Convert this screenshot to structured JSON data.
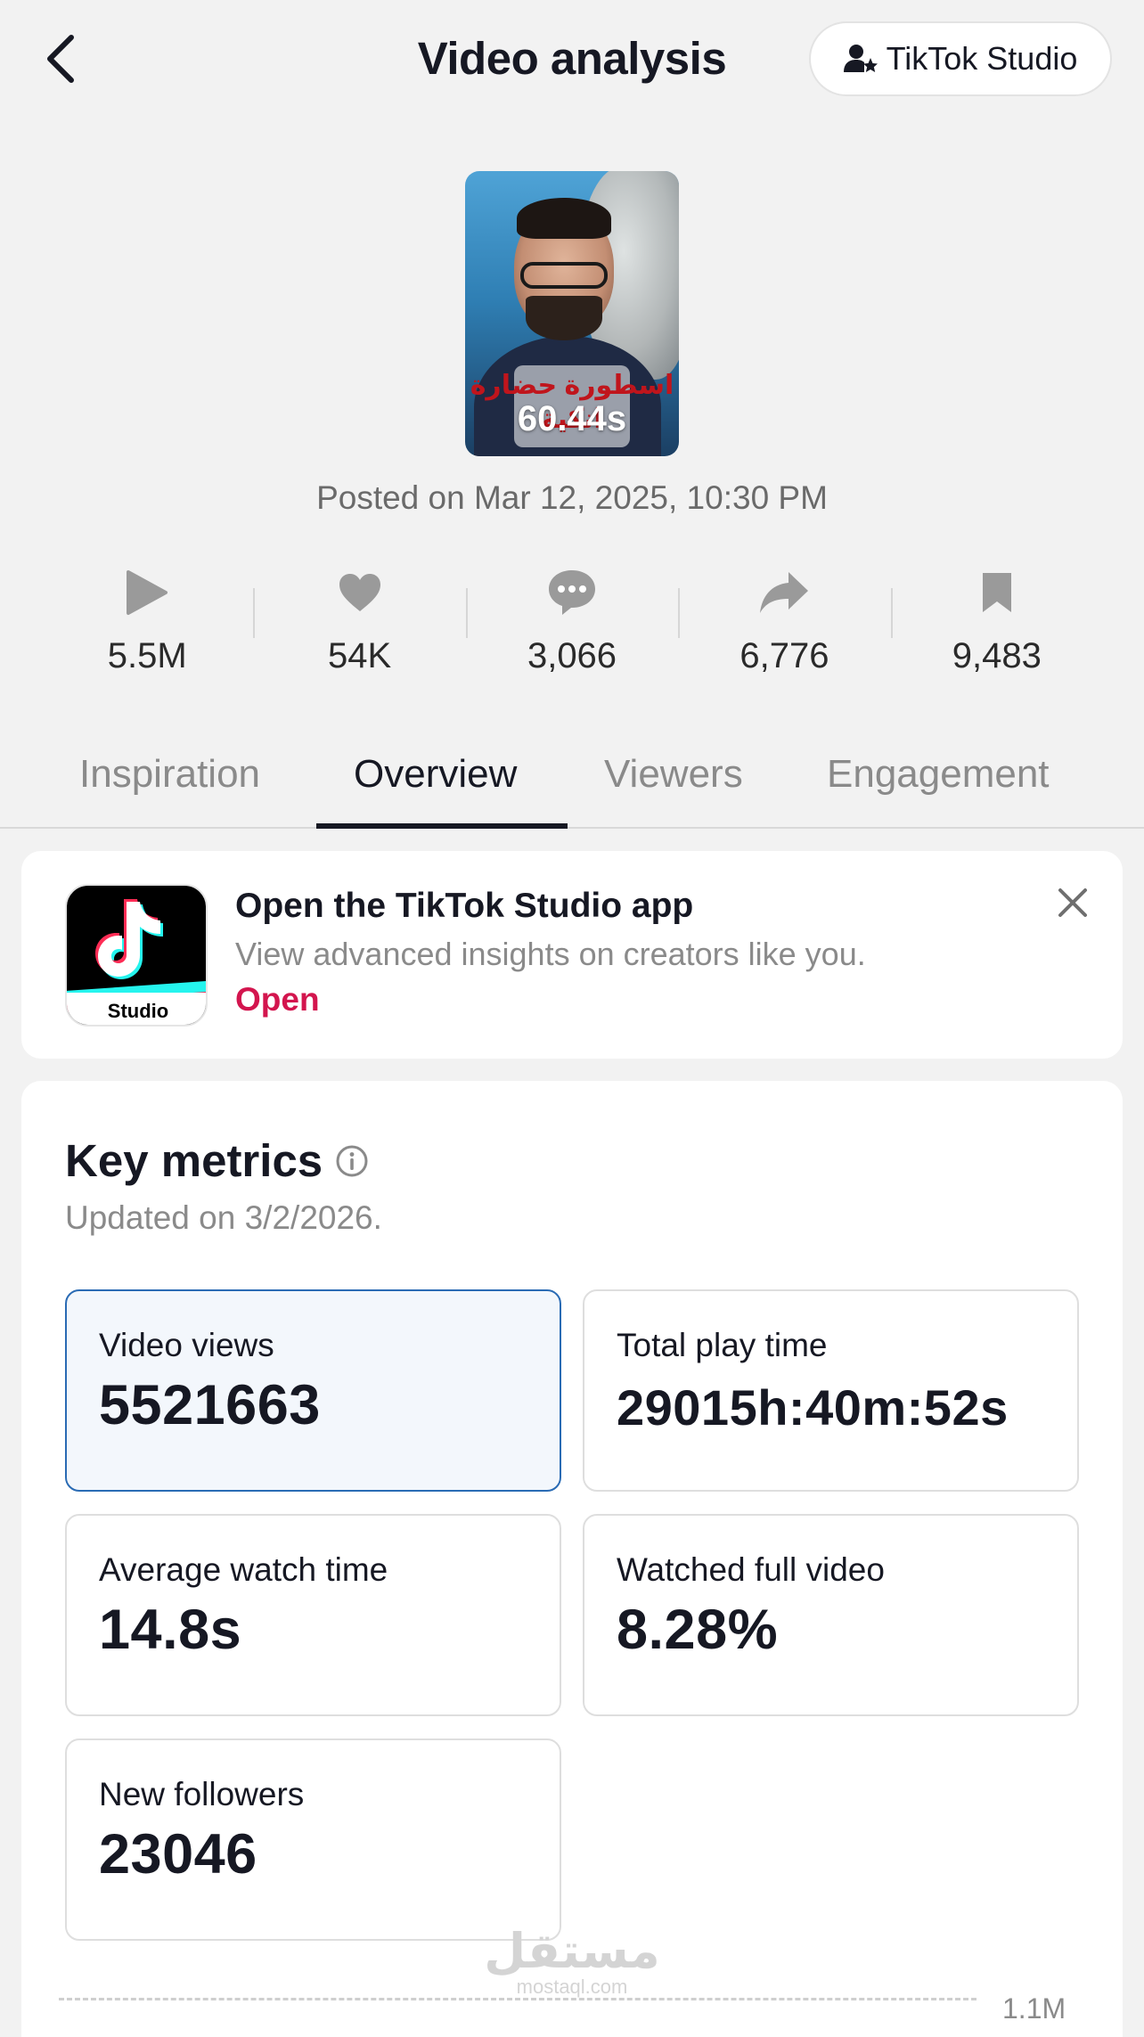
{
  "header": {
    "title": "Video analysis",
    "studio_button": "TikTok Studio"
  },
  "video": {
    "duration": "60.44s",
    "caption_text": "اسطورة حضارة انكية",
    "posted": "Posted on Mar 12, 2025, 10:30 PM"
  },
  "stats": {
    "views": "5.5M",
    "likes": "54K",
    "comments": "3,066",
    "shares": "6,776",
    "saves": "9,483"
  },
  "tabs": {
    "inspiration": "Inspiration",
    "overview": "Overview",
    "viewers": "Viewers",
    "engagement": "Engagement",
    "active": "Overview"
  },
  "banner": {
    "app_icon_label": "Studio",
    "title": "Open the TikTok Studio app",
    "description": "View advanced insights on creators like you.",
    "open_link": "Open"
  },
  "key_metrics": {
    "title": "Key metrics",
    "updated": "Updated on 3/2/2026.",
    "items": [
      {
        "label": "Video views",
        "value": "5521663"
      },
      {
        "label": "Total play time",
        "value": "29015h:40m:52s"
      },
      {
        "label": "Average watch time",
        "value": "14.8s"
      },
      {
        "label": "Watched full video",
        "value": "8.28%"
      },
      {
        "label": "New followers",
        "value": "23046"
      }
    ]
  },
  "chart": {
    "top_tick": "1.1M"
  },
  "watermark": {
    "arabic": "مستقل",
    "latin": "mostaql.com"
  },
  "colors": {
    "accent_red": "#d3154e",
    "active_card_border": "#2a6bb4",
    "active_card_bg": "#f3f7fc"
  }
}
